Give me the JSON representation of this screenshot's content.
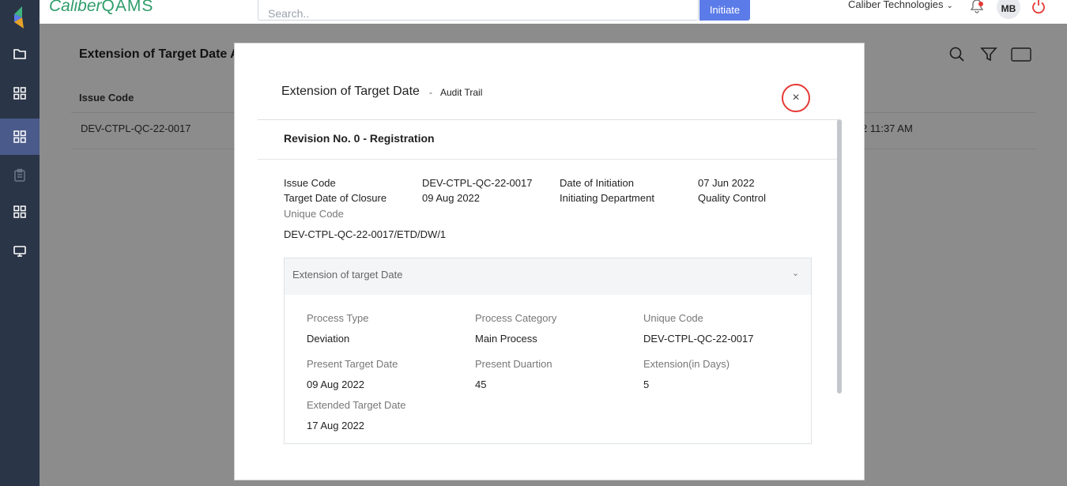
{
  "header": {
    "brand_main": "Caliber",
    "brand_suffix": "QAMS",
    "search_placeholder": "Search..",
    "initiate_label": "Initiate",
    "org_name": "Caliber Technologies",
    "avatar_initials": "MB"
  },
  "page": {
    "title": "Extension of Target Date Au",
    "column_issue_code": "Issue Code",
    "row": {
      "issue_code": "DEV-CTPL-QC-22-0017",
      "date_fragment": "2 11:37 AM"
    }
  },
  "modal": {
    "title": "Extension of Target Date",
    "separator": "-",
    "subtitle": "Audit Trail",
    "close_symbol": "×",
    "revision": "Revision No. 0 - Registration",
    "summary": {
      "issue_code_label": "Issue Code",
      "issue_code_value": "DEV-CTPL-QC-22-0017",
      "date_of_initiation_label": "Date of Initiation",
      "date_of_initiation_value": "07 Jun 2022",
      "target_date_of_closure_label": "Target Date of Closure",
      "target_date_of_closure_value": "09 Aug 2022",
      "initiating_department_label": "Initiating Department",
      "initiating_department_value": "Quality Control",
      "unique_code_label": "Unique Code",
      "unique_code_value": "DEV-CTPL-QC-22-0017/ETD/DW/1"
    },
    "accordion": {
      "title": "Extension of target Date",
      "chevron": "⌄",
      "fields": {
        "process_type_label": "Process Type",
        "process_type_value": "Deviation",
        "process_category_label": "Process Category",
        "process_category_value": "Main Process",
        "unique_code_label": "Unique Code",
        "unique_code_value": "DEV-CTPL-QC-22-0017",
        "present_target_date_label": "Present Target Date",
        "present_target_date_value": "09 Aug 2022",
        "present_duration_label": "Present Duartion",
        "present_duration_value": "45",
        "extension_days_label": "Extension(in Days)",
        "extension_days_value": "5",
        "extended_target_date_label": "Extended Target Date",
        "extended_target_date_value": "17 Aug 2022"
      }
    }
  },
  "colors": {
    "sidebar": "#2a3547",
    "sidebar_active": "#4a5a8a",
    "brand": "#2f9d6b",
    "initiate": "#5b7be8",
    "close_ring": "#e53935"
  },
  "icons": {
    "sidebar": [
      "logo-icon",
      "folder-icon",
      "grid-icon",
      "grid-icon",
      "clipboard-icon",
      "grid-icon",
      "monitor-icon"
    ],
    "header": [
      "bell-icon",
      "power-icon"
    ],
    "toolbar": [
      "search-icon",
      "filter-icon",
      "counter-icon"
    ]
  }
}
